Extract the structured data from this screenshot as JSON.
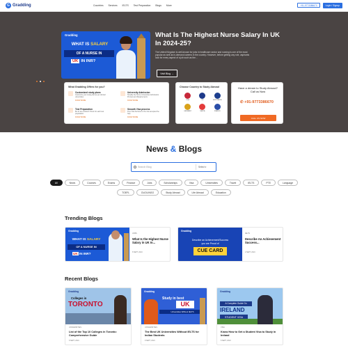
{
  "topbar": {
    "logo": "Gradding",
    "nav": [
      "Countries",
      "Services",
      "IELTS",
      "Test Preparation",
      "Blogs",
      "More"
    ],
    "phone": "+91-9773386670",
    "login": "Login / Signup"
  },
  "hero": {
    "card": {
      "logo": "Gradding",
      "line1_a": "WHAT IS",
      "line1_b": "SALARY",
      "line2": "OF A NURSE IN",
      "uk": "UK",
      "inr": "IN INR?"
    },
    "title": "What Is The Highest Nurse Salary In UK In 2024-25?",
    "desc": "The United Kingdom is well-known for jobs in healthcare sector and nursing is one of the most popular as well as in-demand careers in the country. However, before getting any role, aspirants look for every aspect of a job such as the...",
    "read_btn": "Visit Blog"
  },
  "offers": {
    "title": "What Gradding Offers for you?",
    "items": [
      {
        "title": "Customized study plans",
        "text": "Customize your study plan as per abroad universities",
        "link": "KNOW MORE"
      },
      {
        "title": "University Admission",
        "text": "Simplify the Terms Universities Admissions Process and Requirements",
        "link": "KNOW MORE"
      },
      {
        "title": "Test Preparation",
        "text": "Be an ace student! Check for each test preparation",
        "link": "KNOW MORE"
      },
      {
        "title": "Smooth Visa process",
        "text": "Free Visa Services to the rule accepted the help",
        "link": "KNOW MORE"
      }
    ]
  },
  "countries": {
    "title": "Choose Country to Study Abroad",
    "items": [
      {
        "name": "USA",
        "color": "#c7283a"
      },
      {
        "name": "UK",
        "color": "#1e3a8a"
      },
      {
        "name": "AUSTRALIA",
        "color": "#1d3f8f"
      },
      {
        "name": "GERMANY",
        "color": "#d9a21a"
      },
      {
        "name": "MALTA",
        "color": "#e33b3b"
      },
      {
        "name": "FRANCE",
        "color": "#2a4ea8"
      }
    ]
  },
  "dream": {
    "title": "Have a dream to Study Abroad? Call us Now",
    "phone": "+91-9773386670",
    "button": "CALL US NOW"
  },
  "news": {
    "title_a": "News",
    "amp": "&",
    "title_b": "Blogs",
    "search_placeholder": "Search Blog",
    "select": "Select"
  },
  "pills_row1": [
    "All",
    "News",
    "Courses",
    "Exams",
    "Finance",
    "Jobs",
    "Scholarships",
    "Visa",
    "Universities",
    "Travel",
    "IELTS",
    "PTE",
    "Language"
  ],
  "pills_row2": [
    "TOEFL",
    "DUOLINGO",
    "Study Abroad",
    "Life Abroad",
    "Education"
  ],
  "trending": {
    "title": "Trending Blogs",
    "cards": [
      {
        "tag": "JOBS",
        "title": "What Is the Highest Nurse Salary in UK In...",
        "date": "8 SEPT, 2024",
        "img_color": "#1c5ad6"
      },
      {
        "tag": "IELTS",
        "title": "Describe An Achievement Success...",
        "date": "2 SEPT, 2024",
        "img_color": "#1844b5"
      }
    ],
    "card2_img_text_a": "Describe an Achievement/Success",
    "card2_img_text_b": "you are Proud of",
    "card2_img_text_c": "CUE CARD"
  },
  "recent": {
    "title": "Recent Blogs",
    "cards": [
      {
        "tag": "UNIVERSITIES",
        "title": "List of the Top 10 Colleges in Toronto: Comprehensive Guide",
        "date": "8 SEPT, 2024",
        "img_a": "Colleges in",
        "img_b": "TORONTO"
      },
      {
        "tag": "UNIVERSITIES",
        "title": "The Best UK Universities Without IELTS for Indian Students",
        "date": "8 SEPT, 2024",
        "img_a": "Study in best",
        "img_b": "UK",
        "img_c": "Universities Without IELTS"
      },
      {
        "tag": "VISA",
        "title": "Know How to Get a Student Visa to Study in Ireland",
        "date": "8 SEPT, 2024",
        "img_a": "A Complete Guide On",
        "img_b": "IRELAND",
        "img_c": "STUDENT VISA"
      }
    ]
  }
}
